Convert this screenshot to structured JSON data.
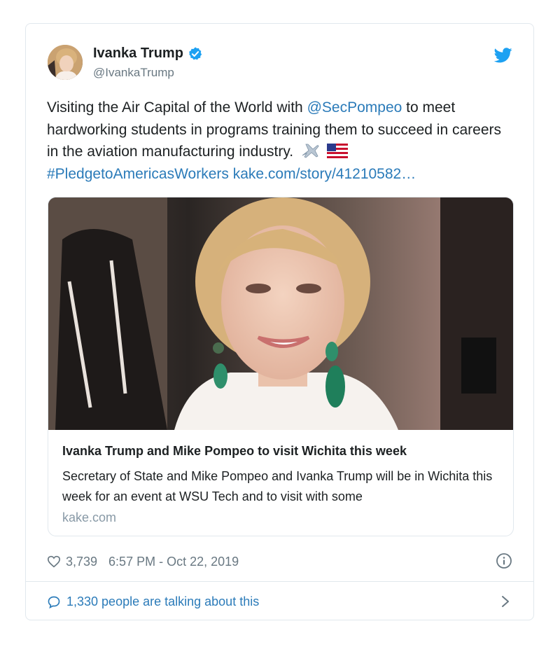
{
  "tweet": {
    "author": {
      "name": "Ivanka Trump",
      "handle": "@IvankaTrump",
      "avatar_icon": "avatar-photo",
      "verified_icon": "verified-badge-icon"
    },
    "brand_icon": "twitter-bird-icon",
    "text": {
      "part1": "Visiting the Air Capital of the World with ",
      "mention": "@SecPompeo",
      "part2": " to meet hardworking students in programs training them to succeed in careers in the aviation manufacturing industry.",
      "emojis": [
        "airplane",
        "us-flag"
      ],
      "hashtag": "#PledgetoAmericasWorkers",
      "url": "kake.com/story/41210582…"
    },
    "card": {
      "title": "Ivanka Trump and Mike Pompeo to visit Wichita this week",
      "description": "Secretary of State and Mike Pompeo and Ivanka Trump will be in Wichita this week for an event at WSU Tech and to visit with some",
      "domain": "kake.com"
    },
    "likes": "3,739",
    "timestamp": "6:57 PM - Oct 22, 2019",
    "talking": "1,330 people are talking about this"
  },
  "colors": {
    "link": "#2b7bb9",
    "verified": "#1da1f2",
    "muted": "#697882",
    "border": "#e1e8ed"
  }
}
